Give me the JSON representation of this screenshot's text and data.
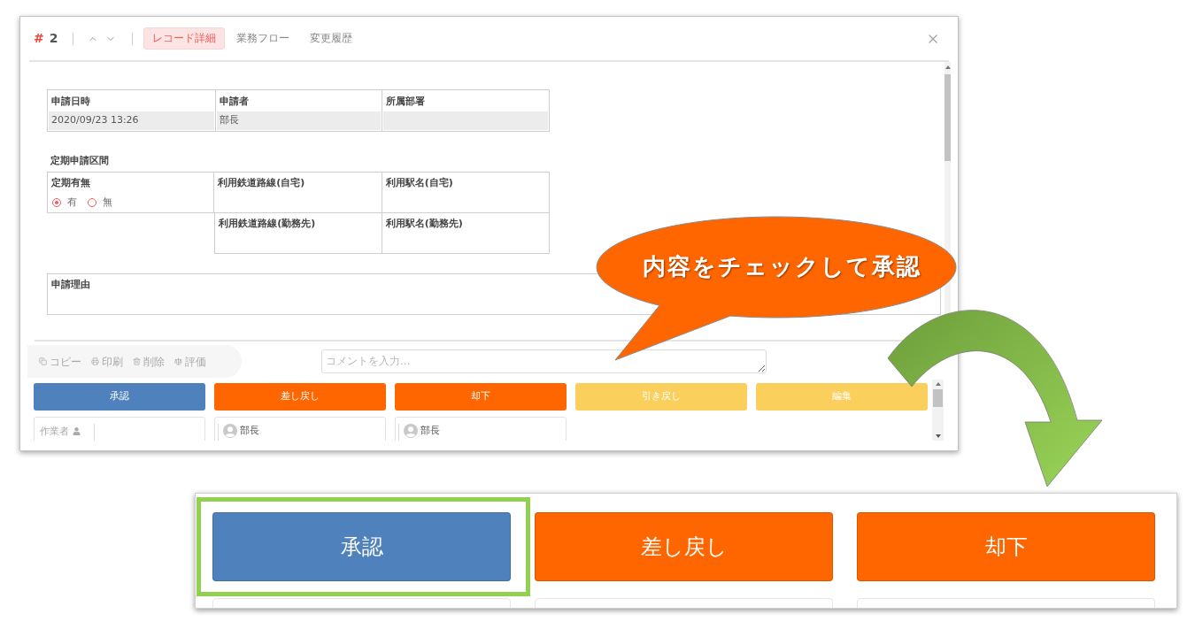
{
  "record": {
    "mark": "#",
    "number": "2"
  },
  "tabs": [
    {
      "label": "レコード詳細",
      "selected": true
    },
    {
      "label": "業務フロー",
      "selected": false
    },
    {
      "label": "変更履歴",
      "selected": false
    }
  ],
  "summary_fields": [
    {
      "label": "申請日時",
      "value": "2020/09/23 13:26"
    },
    {
      "label": "申請者",
      "value": "部長"
    },
    {
      "label": "所属部署"
    }
  ],
  "commute": {
    "title": "定期申請区間",
    "pass_field": {
      "label": "定期有無",
      "options": [
        {
          "label": "有",
          "selected": true
        },
        {
          "label": "無",
          "selected": false
        }
      ]
    },
    "fields": [
      {
        "label": "利用鉄道路線(自宅)"
      },
      {
        "label": "利用駅名(自宅)"
      },
      {
        "label": "利用鉄道路線(勤務先)"
      },
      {
        "label": "利用駅名(勤務先)"
      }
    ]
  },
  "reason_field": {
    "label": "申請理由"
  },
  "toolbar": [
    {
      "label": "コピー"
    },
    {
      "label": "印刷"
    },
    {
      "label": "削除"
    },
    {
      "label": "評価"
    }
  ],
  "comment": {
    "placeholder": "コメントを入力..."
  },
  "actions": [
    {
      "label": "承認",
      "color": "#4f81bd"
    },
    {
      "label": "差し戻し",
      "color": "#ff6600"
    },
    {
      "label": "却下",
      "color": "#ff6600"
    },
    {
      "label": "引き戻し",
      "color": "#fbcf5c"
    },
    {
      "label": "編集",
      "color": "#fbcf5c"
    }
  ],
  "assignees": [
    {
      "kind": "worker",
      "label": "作業者"
    },
    {
      "kind": "user",
      "name": "部長"
    },
    {
      "kind": "user",
      "name": "部長"
    }
  ],
  "callout": {
    "text": "内容をチェックして承認"
  },
  "zoom_panel": {
    "actions": [
      {
        "label": "承認",
        "color": "#4f81bd",
        "highlighted": true
      },
      {
        "label": "差し戻し",
        "color": "#ff6600",
        "highlighted": false
      },
      {
        "label": "却下",
        "color": "#ff6600",
        "highlighted": false
      }
    ]
  }
}
